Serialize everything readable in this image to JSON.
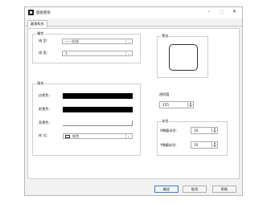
{
  "window": {
    "title": "圆角矩形",
    "controls": {
      "minimize": "–",
      "maximize": "□",
      "close": "✕"
    }
  },
  "tabs": [
    {
      "label": "圆角矩形"
    }
  ],
  "properties": {
    "legend": "属性",
    "line_type": {
      "label": "线 型:",
      "value": "——实线"
    },
    "line_width": {
      "label": "线 宽:",
      "value": "1"
    }
  },
  "preview": {
    "legend": "预览"
  },
  "fill": {
    "legend": "填充",
    "border_color": {
      "label": "边框色:",
      "color": "#000000"
    },
    "foreground_color": {
      "label": "前景色:",
      "color": "#000000"
    },
    "background_color": {
      "label": "背景色:",
      "color": "#ffffff"
    },
    "style": {
      "label": "样 式:",
      "value": "纯色"
    }
  },
  "opacity": {
    "label": "透明度",
    "value": "255"
  },
  "radius": {
    "legend": "半径",
    "x": {
      "label": "X椭圆半径:",
      "value": "10"
    },
    "y": {
      "label": "Y椭圆半径:",
      "value": "10"
    }
  },
  "buttons": {
    "ok": "确定",
    "cancel": "取消",
    "help": "帮助"
  }
}
